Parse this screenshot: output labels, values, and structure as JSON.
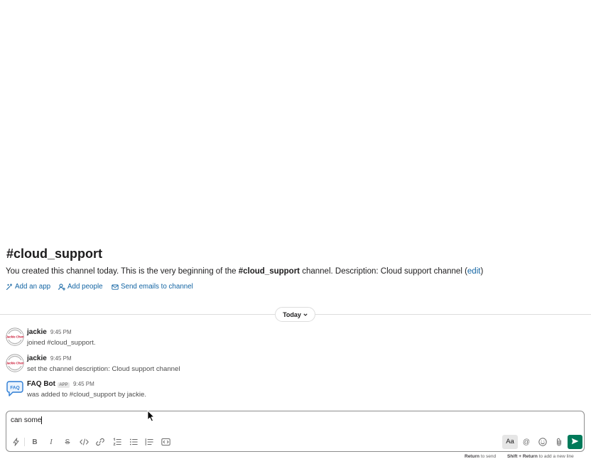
{
  "channel": {
    "name": "#cloud_support",
    "intro": {
      "before": "You created this channel today. This is the very beginning of the ",
      "channel_ref": "#cloud_support",
      "after": " channel. Description: Cloud support channel (",
      "edit_link": "edit",
      "close": ")"
    },
    "actions": [
      {
        "label": "Add an app",
        "icon": "add-app-icon"
      },
      {
        "label": "Add people",
        "icon": "add-person-icon"
      },
      {
        "label": "Send emails to channel",
        "icon": "email-icon"
      }
    ]
  },
  "divider": {
    "label": "Today",
    "icon": "chevron-down-icon"
  },
  "messages": [
    {
      "author": "jackie",
      "time": "9:45 PM",
      "text": "joined #cloud_support.",
      "avatar_text": "Jackie Chen"
    },
    {
      "author": "jackie",
      "time": "9:45 PM",
      "text": "set the channel description: Cloud support channel",
      "avatar_text": "Jackie Chen"
    },
    {
      "author": "FAQ Bot",
      "badge": "APP",
      "time": "9:45 PM",
      "text": "was added to #cloud_support by jackie.",
      "avatar_text": "FAQ"
    }
  ],
  "composer": {
    "value": "can some",
    "formatting": {
      "icons": [
        "lightning-icon",
        "bold-icon",
        "italic-icon",
        "strikethrough-icon",
        "code-icon",
        "link-icon",
        "ordered-list-icon",
        "bulleted-list-icon",
        "blockquote-icon",
        "code-block-icon"
      ],
      "bold_glyph": "B",
      "italic_glyph": "I",
      "strike_glyph": "S"
    },
    "actions": {
      "icons": [
        "text-format-icon",
        "mention-icon",
        "emoji-icon",
        "attach-icon",
        "send-icon"
      ],
      "text_format_label": "Aa",
      "mention_glyph": "@"
    },
    "hint": {
      "send_key": "Return",
      "send_text": " to send",
      "newline_key": "Shift + Return",
      "newline_text": " to add a new line"
    }
  },
  "colors": {
    "link": "#1264a3",
    "text": "#1d1c1d",
    "muted": "#616061",
    "send_button": "#007a5a",
    "avatar_lettering": "#c8102e",
    "faq_icon": "#2b7bd4"
  }
}
